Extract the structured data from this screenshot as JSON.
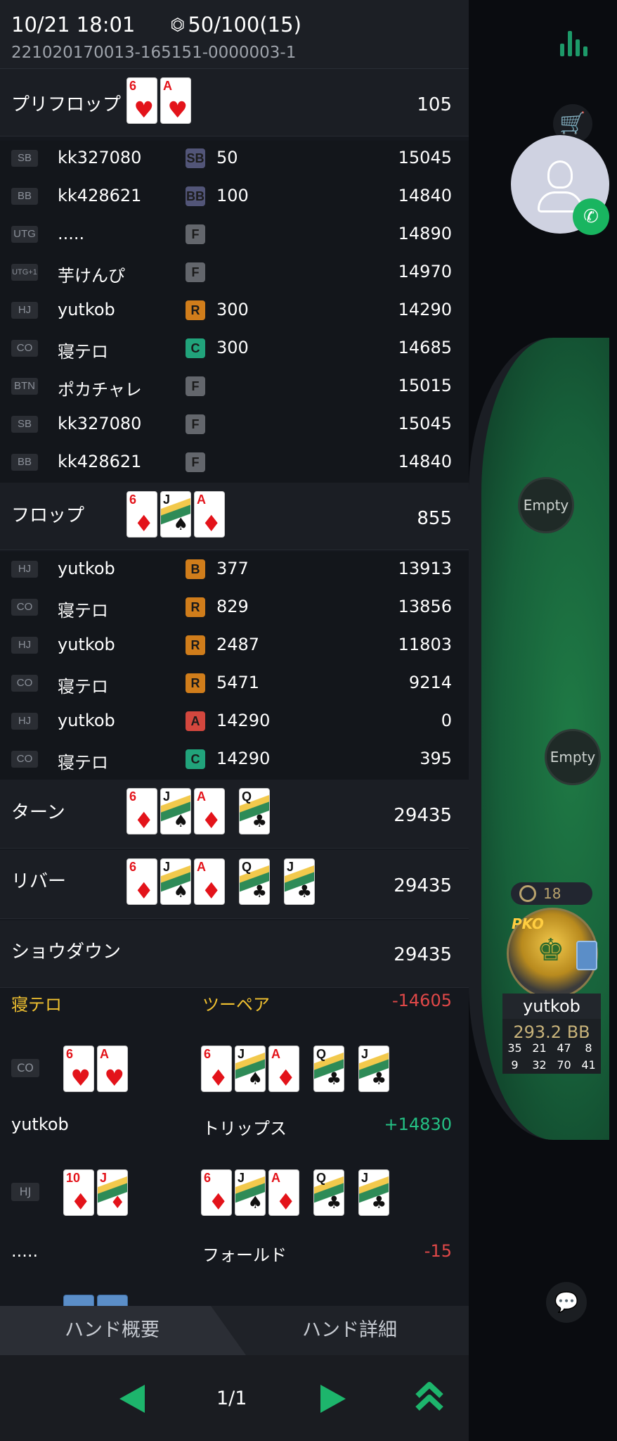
{
  "header": {
    "datetime": "10/21 18:01",
    "blinds": "50/100(15)",
    "hand_id": "221020170013-165151-0000003-1"
  },
  "preflop": {
    "name": "プリフロップ",
    "pot": "105",
    "cards": [
      {
        "rank": "6",
        "suit": "♥",
        "color": "red"
      },
      {
        "rank": "A",
        "suit": "♥",
        "color": "red"
      }
    ]
  },
  "preflop_rows": [
    {
      "pos": "SB",
      "player": "kk327080",
      "action": "SB",
      "amount": "50",
      "stack": "15045"
    },
    {
      "pos": "BB",
      "player": "kk428621",
      "action": "BB",
      "amount": "100",
      "stack": "14840"
    },
    {
      "pos": "UTG",
      "player": ".....",
      "action": "F",
      "amount": "",
      "stack": "14890"
    },
    {
      "pos": "UTG+1",
      "player": "芋けんぴ",
      "action": "F",
      "amount": "",
      "stack": "14970"
    },
    {
      "pos": "HJ",
      "player": "yutkob",
      "action": "R",
      "amount": "300",
      "stack": "14290"
    },
    {
      "pos": "CO",
      "player": "寝テロ",
      "action": "C",
      "amount": "300",
      "stack": "14685"
    },
    {
      "pos": "BTN",
      "player": "ポカチャレ",
      "action": "F",
      "amount": "",
      "stack": "15015"
    },
    {
      "pos": "SB",
      "player": "kk327080",
      "action": "F",
      "amount": "",
      "stack": "15045"
    },
    {
      "pos": "BB",
      "player": "kk428621",
      "action": "F",
      "amount": "",
      "stack": "14840"
    }
  ],
  "flop": {
    "name": "フロップ",
    "pot": "855",
    "cards": [
      {
        "rank": "6",
        "suit": "♦",
        "color": "red"
      },
      {
        "rank": "J",
        "suit": "♠",
        "color": "blk",
        "face": true
      },
      {
        "rank": "A",
        "suit": "♦",
        "color": "red"
      }
    ]
  },
  "flop_rows": [
    {
      "pos": "HJ",
      "player": "yutkob",
      "action": "B",
      "amount": "377",
      "stack": "13913"
    },
    {
      "pos": "CO",
      "player": "寝テロ",
      "action": "R",
      "amount": "829",
      "stack": "13856"
    },
    {
      "pos": "HJ",
      "player": "yutkob",
      "action": "R",
      "amount": "2487",
      "stack": "11803"
    },
    {
      "pos": "CO",
      "player": "寝テロ",
      "action": "R",
      "amount": "5471",
      "stack": "9214"
    },
    {
      "pos": "HJ",
      "player": "yutkob",
      "action": "A",
      "amount": "14290",
      "stack": "0"
    },
    {
      "pos": "CO",
      "player": "寝テロ",
      "action": "C",
      "amount": "14290",
      "stack": "395"
    }
  ],
  "turn": {
    "name": "ターン",
    "pot": "29435",
    "cards": [
      {
        "rank": "6",
        "suit": "♦",
        "color": "red"
      },
      {
        "rank": "J",
        "suit": "♠",
        "color": "blk",
        "face": true
      },
      {
        "rank": "A",
        "suit": "♦",
        "color": "red"
      },
      {
        "rank": "Q",
        "suit": "♣",
        "color": "blk",
        "face": true,
        "gap": true
      }
    ]
  },
  "river": {
    "name": "リバー",
    "pot": "29435",
    "cards": [
      {
        "rank": "6",
        "suit": "♦",
        "color": "red"
      },
      {
        "rank": "J",
        "suit": "♠",
        "color": "blk",
        "face": true
      },
      {
        "rank": "A",
        "suit": "♦",
        "color": "red"
      },
      {
        "rank": "Q",
        "suit": "♣",
        "color": "blk",
        "face": true,
        "gap": true
      },
      {
        "rank": "J",
        "suit": "♣",
        "color": "blk",
        "face": true,
        "gap": true
      }
    ]
  },
  "showdown": {
    "name": "ショウダウン",
    "pot": "29435"
  },
  "results": [
    {
      "player": "寝テロ",
      "player_color": "#f2c230",
      "hand": "ツーペア",
      "hand_color": "#f2c230",
      "result": "-14605",
      "result_color": "#e04848",
      "pos": "CO",
      "hole": [
        {
          "rank": "6",
          "suit": "♥",
          "color": "red"
        },
        {
          "rank": "A",
          "suit": "♥",
          "color": "red"
        }
      ],
      "board": [
        {
          "rank": "6",
          "suit": "♦",
          "color": "red"
        },
        {
          "rank": "J",
          "suit": "♠",
          "color": "blk",
          "face": true
        },
        {
          "rank": "A",
          "suit": "♦",
          "color": "red"
        },
        {
          "rank": "Q",
          "suit": "♣",
          "color": "blk",
          "face": true,
          "gap": true
        },
        {
          "rank": "J",
          "suit": "♣",
          "color": "blk",
          "face": true,
          "gap": true
        }
      ]
    },
    {
      "player": "yutkob",
      "player_color": "#ffffff",
      "hand": "トリップス",
      "hand_color": "#ffffff",
      "result": "+14830",
      "result_color": "#24c084",
      "pos": "HJ",
      "hole": [
        {
          "rank": "10",
          "suit": "♦",
          "color": "red"
        },
        {
          "rank": "J",
          "suit": "♦",
          "color": "red",
          "face": true
        }
      ],
      "board": [
        {
          "rank": "6",
          "suit": "♦",
          "color": "red"
        },
        {
          "rank": "J",
          "suit": "♠",
          "color": "blk",
          "face": true
        },
        {
          "rank": "A",
          "suit": "♦",
          "color": "red"
        },
        {
          "rank": "Q",
          "suit": "♣",
          "color": "blk",
          "face": true,
          "gap": true
        },
        {
          "rank": "J",
          "suit": "♣",
          "color": "blk",
          "face": true,
          "gap": true
        }
      ]
    },
    {
      "player": ".....",
      "player_color": "#ffffff",
      "hand": "フォールド",
      "hand_color": "#ffffff",
      "result": "-15",
      "result_color": "#e04848"
    }
  ],
  "tabs": {
    "summary": "ハンド概要",
    "detail": "ハンド詳細"
  },
  "pager": {
    "page": "1/1"
  },
  "table": {
    "empty_seat_1": "Empty",
    "empty_seat_2": "Empty",
    "hero_name": "yutkob",
    "hero_stack": "293.2 BB",
    "bounty": "18",
    "pko_label": "PKO",
    "stats": [
      "35",
      "21",
      "47",
      "8",
      "9",
      "32",
      "70",
      "41"
    ]
  },
  "icons": {
    "stats": "bar-chart-icon",
    "cart": "cart-icon",
    "call": "phone-icon",
    "chat": "chat-icon",
    "up": "double-chevron-up-icon"
  },
  "colors": {
    "accent": "#1db56c"
  }
}
